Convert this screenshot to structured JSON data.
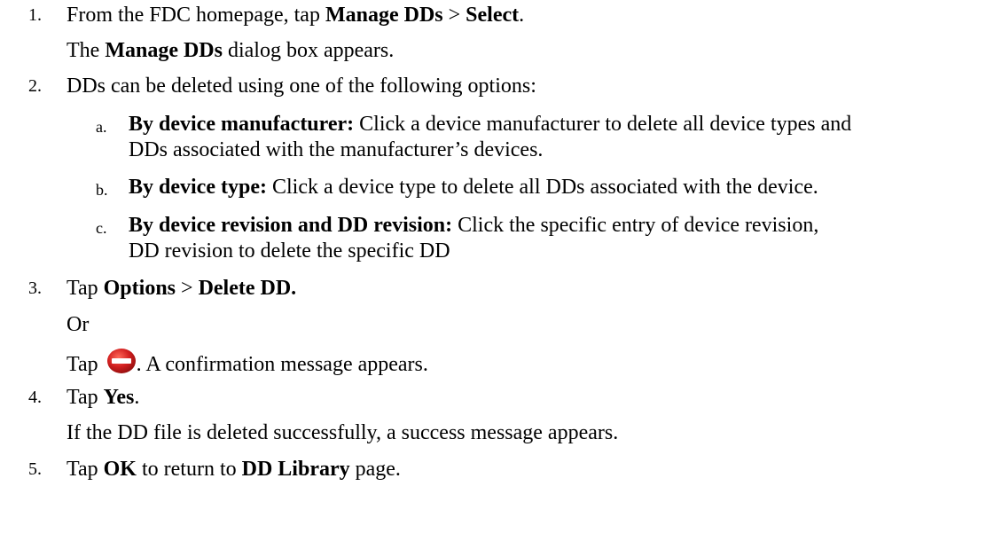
{
  "steps": [
    {
      "number": "1.",
      "parts": [
        "From the FDC homepage, tap ",
        "Manage DDs",
        " > ",
        "Select",
        "."
      ],
      "note_parts": [
        "The ",
        "Manage DDs",
        " dialog box appears."
      ]
    },
    {
      "number": "2.",
      "text": "DDs can be deleted using one of the following options:",
      "options": [
        {
          "letter": "a.",
          "label": "By device manufacturer:",
          "line1": " Click a device manufacturer to delete all device types and",
          "line2": "DDs associated with the manufacturer’s devices."
        },
        {
          "letter": "b.",
          "label": "By device type:",
          "line1": " Click a device type to delete all DDs associated with the device."
        },
        {
          "letter": "c.",
          "label": "By device revision and DD revision:",
          "line1": " Click the specific entry of device revision,",
          "line2": "DD revision to delete the specific DD"
        }
      ]
    },
    {
      "number": "3.",
      "parts": [
        "Tap ",
        "Options",
        " > ",
        "Delete DD."
      ],
      "or_text": "Or",
      "tap_icon_parts": [
        "Tap ",
        ". A confirmation message appears."
      ],
      "icon": "delete-icon"
    },
    {
      "number": "4.",
      "parts": [
        "Tap ",
        "Yes",
        "."
      ],
      "note": "If the DD file is deleted successfully, a success message appears."
    },
    {
      "number": "5.",
      "parts": [
        "Tap ",
        "OK",
        " to return to ",
        "DD Library",
        " page."
      ]
    }
  ],
  "colors": {
    "text": "#000000",
    "icon_red": "#d21f1f",
    "icon_bar": "#ffffff"
  }
}
